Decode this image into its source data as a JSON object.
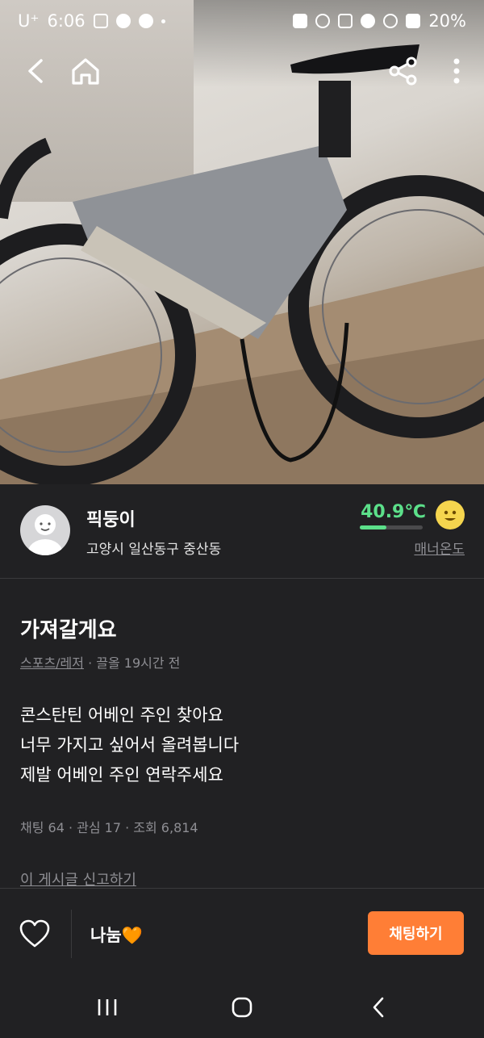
{
  "status_bar": {
    "carrier": "U⁺",
    "time": "6:06",
    "battery": "20%",
    "left_icons": [
      "instagram-icon",
      "facebook-icon",
      "app-one-icon",
      "notification-dot"
    ],
    "right_icons": [
      "save-icon",
      "alarm-icon",
      "mute-icon",
      "location-icon",
      "wifi-icon",
      "signal-icon"
    ]
  },
  "top_nav": {
    "icons": [
      "back-icon",
      "home-icon",
      "share-icon",
      "more-icon"
    ]
  },
  "seller": {
    "name": "픽둥이",
    "location": "고양시 일산동구 중산동",
    "temperature": "40.9℃",
    "temperature_level": 0.42,
    "manner_label": "매너온도"
  },
  "post": {
    "title": "가져갈게요",
    "category": "스포츠/레저",
    "time_info": "· 끌올 19시간 전",
    "body_lines": [
      "콘스탄틴 어베인 주인 찾아요",
      "너무 가지고 싶어서 올려봅니다",
      "제발 어베인 주인 연락주세요"
    ],
    "stats": "채팅 64 · 관심 17 · 조회 6,814",
    "report_label": "이 게시글 신고하기"
  },
  "bottom_bar": {
    "price": "나눔🧡",
    "chat_button": "채팅하기"
  },
  "colors": {
    "background": "#212123",
    "accent": "#ff7e36",
    "temperature": "#5ce08a",
    "muted": "#8e8e93"
  }
}
